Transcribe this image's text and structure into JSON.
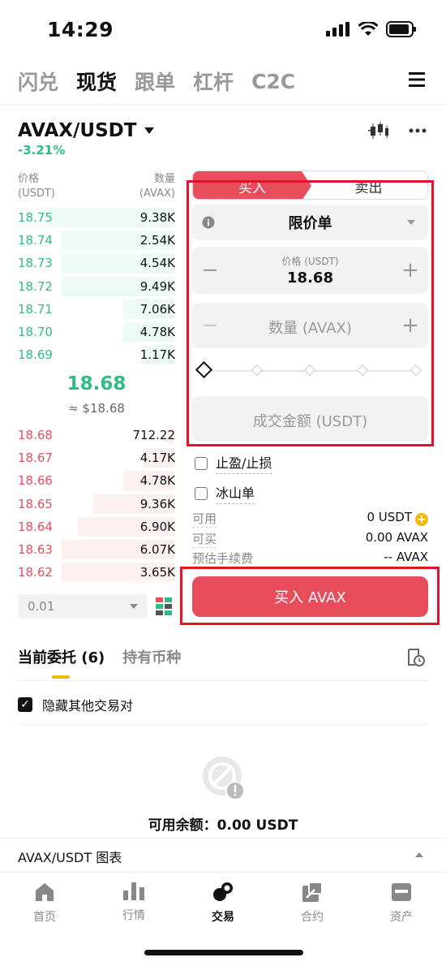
{
  "status": {
    "time": "14:29"
  },
  "top_tabs": [
    "闪兑",
    "现货",
    "跟单",
    "杠杆",
    "C2C"
  ],
  "pair": {
    "name": "AVAX/USDT",
    "change": "-3.21%"
  },
  "order_book": {
    "price_header_1": "价格",
    "price_header_2": "(USDT)",
    "qty_header_1": "数量",
    "qty_header_2": "(AVAX)",
    "asks_label": "buy side (green, above)",
    "buys": [
      {
        "price": "18.75",
        "qty": "9.38K",
        "depth": 0.8
      },
      {
        "price": "18.74",
        "qty": "2.54K",
        "depth": 0.72
      },
      {
        "price": "18.73",
        "qty": "4.54K",
        "depth": 0.72
      },
      {
        "price": "18.72",
        "qty": "9.49K",
        "depth": 0.72
      },
      {
        "price": "18.71",
        "qty": "7.06K",
        "depth": 0.33
      },
      {
        "price": "18.70",
        "qty": "4.78K",
        "depth": 0.33
      },
      {
        "price": "18.69",
        "qty": "1.17K",
        "depth": 0.2
      }
    ],
    "mid_price": "18.68",
    "mid_fiat": "≈ $18.68",
    "sells": [
      {
        "price": "18.68",
        "qty": "712.22",
        "depth": 0.05
      },
      {
        "price": "18.67",
        "qty": "4.17K",
        "depth": 0.2
      },
      {
        "price": "18.66",
        "qty": "4.78K",
        "depth": 0.33
      },
      {
        "price": "18.65",
        "qty": "9.36K",
        "depth": 0.52
      },
      {
        "price": "18.64",
        "qty": "6.90K",
        "depth": 0.62
      },
      {
        "price": "18.63",
        "qty": "6.07K",
        "depth": 0.72
      },
      {
        "price": "18.62",
        "qty": "3.65K",
        "depth": 0.72
      }
    ],
    "depth_value": "0.01"
  },
  "trade": {
    "buy_label": "买入",
    "sell_label": "卖出",
    "order_type": "限价单",
    "price_label": "价格 (USDT)",
    "price_value": "18.68",
    "qty_placeholder": "数量 (AVAX)",
    "amount_placeholder": "成交金额 (USDT)",
    "tp_sl": "止盈/止损",
    "iceberg": "冰山单",
    "available_label": "可用",
    "available_value": "0 USDT",
    "can_buy_label": "可买",
    "can_buy_value": "0.00 AVAX",
    "fee_label": "预估手续费",
    "fee_value": "-- AVAX",
    "submit_label": "买入 AVAX"
  },
  "orders": {
    "tab_open": "当前委托 (6)",
    "tab_holdings": "持有币种",
    "hide_other": "隐藏其他交易对",
    "available_balance": "可用余额：0.00 USDT",
    "chart_label": "AVAX/USDT 图表"
  },
  "bottom_nav": [
    "首页",
    "行情",
    "交易",
    "合约",
    "资产"
  ],
  "colors": {
    "up": "#2ebd85",
    "down": "#e84d5c",
    "accent": "#f0b90b",
    "highlight": "#e3122b"
  }
}
